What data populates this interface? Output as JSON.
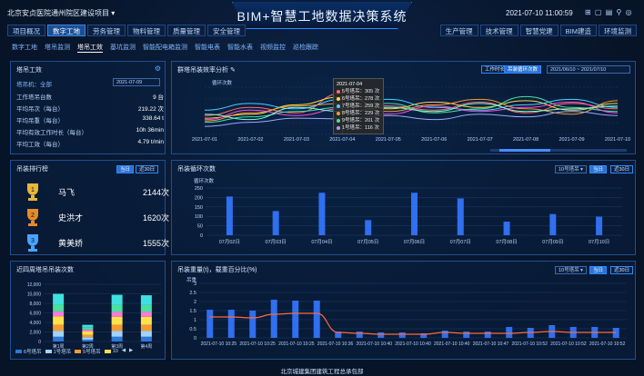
{
  "header": {
    "project": "北京安贞医院通州院区建设项目",
    "system_title": "BIM+智慧工地数据决策系统",
    "datetime": "2021-07-10 11:00:59",
    "icons": "⊞ ▢ ▤ ⚲ ◎",
    "dropdown_caret": "▾"
  },
  "nav_left": [
    "项目概况",
    "数字工地",
    "劳务管理",
    "物料管理",
    "质量管理",
    "安全管理"
  ],
  "nav_left_active": 1,
  "nav_right": [
    "生产管理",
    "技术管理",
    "智慧党建",
    "BIM建造",
    "环境监测"
  ],
  "subnav": [
    "数字工地",
    "塔吊监测",
    "塔吊工效",
    "基坑监测",
    "智能配电箱监测",
    "智能电表",
    "智能水表",
    "视频监控",
    "巡检跟踪"
  ],
  "subnav_active": 2,
  "tower": {
    "title": "塔吊工效",
    "gear": "⚙",
    "filter_label": "塔吊机：全部",
    "date": "2021-07-09",
    "stats": [
      {
        "label": "工作塔吊台数",
        "value": "9 台"
      },
      {
        "label": "平均吊次（每台）",
        "value": "219.22 次"
      },
      {
        "label": "平均吊重（每台）",
        "value": "338.64 t"
      },
      {
        "label": "平均有效工作时长（每台）",
        "value": "10h 36min"
      },
      {
        "label": "平均工效（每台）",
        "value": "4.79 t/min"
      }
    ]
  },
  "efficiency": {
    "title": "群塔吊装效率分析",
    "edit_icon": "✎",
    "btn1": "工作时长",
    "btn2": "吊装循环次数",
    "date_from": "2021/06/10",
    "date_to": "2021/07/10",
    "date_sep": "~",
    "ylabel": "循环次数"
  },
  "tooltip": {
    "title": "2021-07-04",
    "rows": [
      "5号塔吊：305 次",
      "6号塔吊：278 次",
      "7号塔吊：259 次",
      "8号塔吊：229 次",
      "9号塔吊：201 次",
      "1号塔吊：116 次"
    ],
    "colors": [
      "#ff6b6b",
      "#ffd84a",
      "#4ad0ff",
      "#f39c34",
      "#4ae0a0",
      "#9aa9ff"
    ]
  },
  "ranking": {
    "title": "吊装排行榜",
    "btn1": "当日",
    "btn2": "近30日",
    "items": [
      {
        "rank": "1",
        "name": "马飞",
        "count": "2144次",
        "color": "#e8b63a"
      },
      {
        "rank": "2",
        "name": "史洪才",
        "count": "1620次",
        "color": "#e58a2a"
      },
      {
        "rank": "3",
        "name": "黄美娇",
        "count": "1555次",
        "color": "#4aa3ff"
      }
    ]
  },
  "cycle": {
    "title": "吊装循环次数",
    "dropdown": "10号塔吊",
    "btn1": "当日",
    "btn2": "近30日",
    "ylabel": "循环次数"
  },
  "stacked": {
    "title": "近四周塔吊吊装次数"
  },
  "weight": {
    "title": "吊装重量(t)，载重百分比(%)",
    "dropdown": "10号塔吊",
    "btn1": "当日",
    "btn2": "近30日",
    "ylabel": "吊重"
  },
  "footer": "北京城建集团建筑工程总承包部",
  "chart_data": [
    {
      "type": "line",
      "title": "群塔吊装效率分析",
      "ylabel": "循环次数",
      "x": [
        "2021-07-01",
        "2021-07-02",
        "2021-07-03",
        "2021-07-04",
        "2021-07-05",
        "2021-07-06",
        "2021-07-07",
        "2021-07-08",
        "2021-07-09",
        "2021-07-10"
      ],
      "series": [
        {
          "name": "5号塔吊",
          "color": "#ff6b6b",
          "values": [
            140,
            200,
            160,
            305,
            210,
            180,
            240,
            160,
            230,
            190
          ]
        },
        {
          "name": "6号塔吊",
          "color": "#ffd84a",
          "values": [
            120,
            150,
            220,
            278,
            190,
            240,
            200,
            250,
            180,
            230
          ]
        },
        {
          "name": "7号塔吊",
          "color": "#4ad0ff",
          "values": [
            180,
            230,
            190,
            259,
            260,
            200,
            180,
            220,
            260,
            200
          ]
        },
        {
          "name": "8号塔吊",
          "color": "#f39c34",
          "values": [
            100,
            160,
            210,
            229,
            170,
            220,
            260,
            190,
            150,
            250
          ]
        },
        {
          "name": "9号塔吊",
          "color": "#4ae0a0",
          "values": [
            90,
            130,
            170,
            201,
            230,
            160,
            190,
            280,
            200,
            170
          ]
        },
        {
          "name": "1号塔吊",
          "color": "#9aa9ff",
          "values": [
            60,
            90,
            120,
            116,
            140,
            110,
            150,
            130,
            170,
            140
          ]
        },
        {
          "color": "#ff4ad8",
          "values": [
            110,
            180,
            140,
            190,
            150,
            210,
            170,
            200,
            240,
            160
          ]
        },
        {
          "color": "#7affd0",
          "values": [
            150,
            110,
            200,
            170,
            200,
            170,
            230,
            170,
            190,
            210
          ]
        }
      ],
      "ylim": [
        0,
        350
      ]
    },
    {
      "type": "bar",
      "title": "吊装循环次数",
      "ylabel": "循环次数",
      "categories": [
        "07月02日",
        "07月03日",
        "07月04日",
        "07月05日",
        "07月06日",
        "07月07日",
        "07月08日",
        "07月09日",
        "07月10日"
      ],
      "values": [
        205,
        128,
        225,
        80,
        225,
        195,
        72,
        112,
        98
      ],
      "yticks": [
        0,
        50,
        100,
        150,
        200,
        250
      ],
      "ylim": [
        0,
        250
      ]
    },
    {
      "type": "bar",
      "title": "近四周塔吊吊装次数",
      "categories": [
        "第1周",
        "第2周",
        "第3周",
        "第4周"
      ],
      "yticks": [
        "0",
        "2,000",
        "4,000",
        "6,000",
        "8,000",
        "10,000",
        "12,000"
      ],
      "ylim": [
        0,
        12000
      ],
      "series": [
        {
          "name": "6号塔吊",
          "color": "#2a7ad8",
          "values": [
            1000,
            400,
            1000,
            1000
          ]
        },
        {
          "name": "1号塔吊",
          "color": "#9fd4ff",
          "values": [
            1200,
            500,
            1200,
            1200
          ]
        },
        {
          "name": "5号塔吊",
          "color": "#f39c34",
          "values": [
            1300,
            500,
            1300,
            1300
          ]
        },
        {
          "name": "10",
          "color": "#ffe24a",
          "values": [
            1800,
            700,
            1700,
            1700
          ]
        },
        {
          "color": "#ff7ad8",
          "values": [
            1000,
            400,
            1000,
            1000
          ]
        },
        {
          "color": "#4ae0a0",
          "values": [
            1500,
            500,
            1500,
            1500
          ]
        },
        {
          "color": "#3fe0e0",
          "values": [
            2200,
            500,
            2100,
            2000
          ]
        }
      ],
      "legend": [
        "6号塔吊",
        "1号塔吊",
        "5号塔吊",
        "10"
      ],
      "legend_nav": [
        "◀",
        "▶"
      ]
    },
    {
      "type": "bar",
      "title": "吊装重量(t)，载重百分比(%)",
      "ylabel": "吊重",
      "categories": [
        "2021-07-10 10:25",
        "2021-07-10 10:25",
        "2021-07-10 10:25",
        "2021-07-10 10:36",
        "2021-07-10 10:40",
        "2021-07-10 10:40",
        "2021-07-10 10:40",
        "2021-07-10 10:47",
        "2021-07-10 10:52",
        "2021-07-10 10:52",
        "2021-07-10 10:52"
      ],
      "yticks": [
        "0",
        "0.5",
        "1",
        "1.5",
        "2",
        "2.5",
        "3"
      ],
      "ylim": [
        0,
        3
      ],
      "values": [
        1.55,
        1.55,
        1.5,
        2.1,
        2.05,
        2.05,
        0.35,
        0.35,
        0.3,
        0.3,
        0.25,
        0.4,
        0.35,
        0.35,
        0.6,
        0.55,
        0.7,
        0.6,
        0.6,
        0.55
      ],
      "line": [
        1.15,
        1.15,
        1.1,
        1.3,
        1.35,
        1.35,
        0.3,
        0.25,
        0.2,
        0.2,
        0.2,
        0.3,
        0.25,
        0.25,
        0.25,
        0.3,
        0.35,
        0.3,
        0.3,
        0.3
      ],
      "line_color": "#ff6a3a"
    }
  ]
}
